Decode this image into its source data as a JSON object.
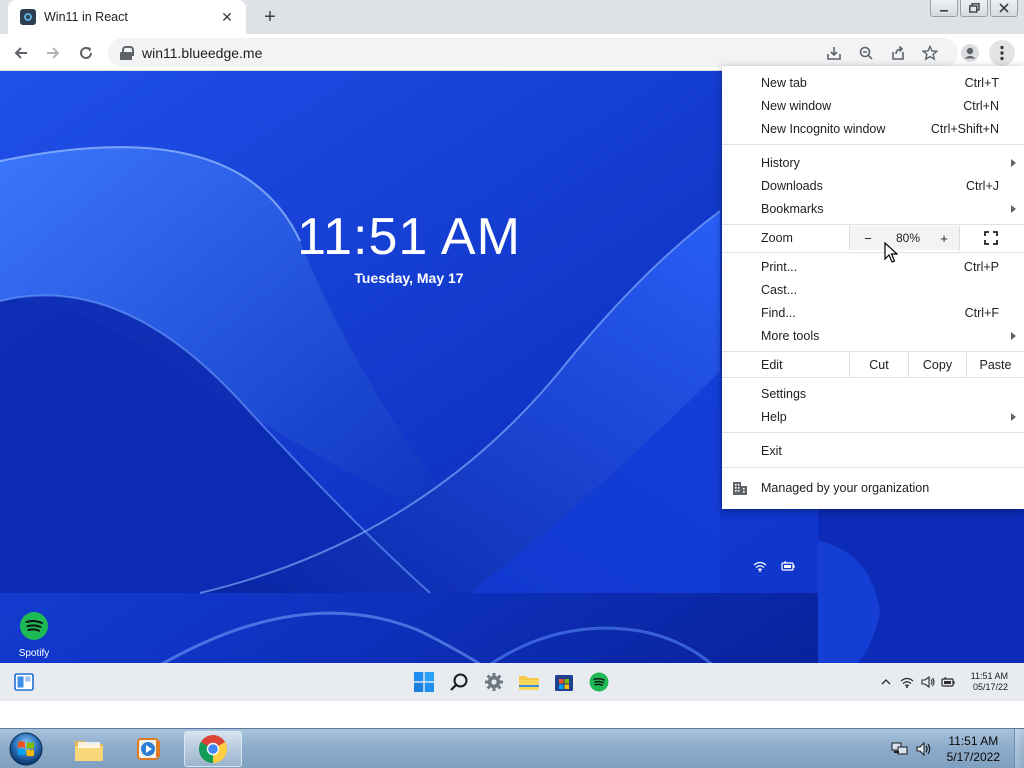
{
  "browser": {
    "tab_title": "Win11 in React",
    "url": "win11.blueedge.me",
    "tab_close": "✕",
    "new_tab": "+"
  },
  "lockscreen": {
    "time": "11:51 AM",
    "date": "Tuesday, May 17"
  },
  "desktop": {
    "icons": [
      {
        "label": "Spotify"
      }
    ]
  },
  "win11_taskbar": {
    "clock_time": "11:51 AM",
    "clock_date": "05/17/22"
  },
  "chrome_menu": {
    "new_tab": {
      "label": "New tab",
      "shortcut": "Ctrl+T"
    },
    "new_window": {
      "label": "New window",
      "shortcut": "Ctrl+N"
    },
    "new_incognito": {
      "label": "New Incognito window",
      "shortcut": "Ctrl+Shift+N"
    },
    "history": {
      "label": "History"
    },
    "downloads": {
      "label": "Downloads",
      "shortcut": "Ctrl+J"
    },
    "bookmarks": {
      "label": "Bookmarks"
    },
    "zoom": {
      "label": "Zoom",
      "minus": "−",
      "value": "80%",
      "plus": "+"
    },
    "print": {
      "label": "Print...",
      "shortcut": "Ctrl+P"
    },
    "cast": {
      "label": "Cast..."
    },
    "find": {
      "label": "Find...",
      "shortcut": "Ctrl+F"
    },
    "more_tools": {
      "label": "More tools"
    },
    "edit": {
      "label": "Edit",
      "cut": "Cut",
      "copy": "Copy",
      "paste": "Paste"
    },
    "settings": {
      "label": "Settings"
    },
    "help": {
      "label": "Help"
    },
    "exit": {
      "label": "Exit"
    },
    "managed": {
      "label": "Managed by your organization"
    }
  },
  "win7_taskbar": {
    "clock_time": "11:51 AM",
    "clock_date": "5/17/2022"
  },
  "colors": {
    "wallpaper_blue": "#1a3bc7",
    "spotify_green": "#1db954",
    "win7_taskbar": "#8eaccb"
  }
}
